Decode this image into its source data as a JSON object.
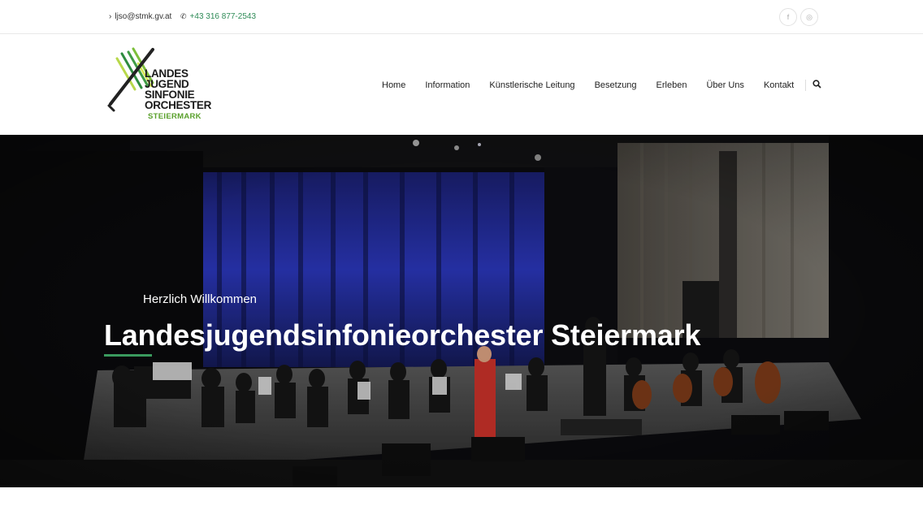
{
  "topbar": {
    "email": "ljso@stmk.gv.at",
    "phone": "+43 316 877-2543",
    "social": [
      "facebook-icon",
      "instagram-icon"
    ]
  },
  "logo": {
    "lines": [
      "LANDES",
      "JUGEND",
      "SINFONIE",
      "ORCHESTER"
    ],
    "sub": "STEIERMARK"
  },
  "nav": {
    "items": [
      "Home",
      "Information",
      "Künstlerische Leitung",
      "Besetzung",
      "Erleben",
      "Über Uns",
      "Kontakt"
    ],
    "search_icon": "search-icon"
  },
  "hero": {
    "subtitle": "Herzlich Willkommen",
    "title": "Landesjugendsinfonieorchester Steiermark"
  },
  "colors": {
    "accent": "#3a9a5e",
    "phone": "#2e8b57",
    "logo_green": "#5aa02c"
  }
}
